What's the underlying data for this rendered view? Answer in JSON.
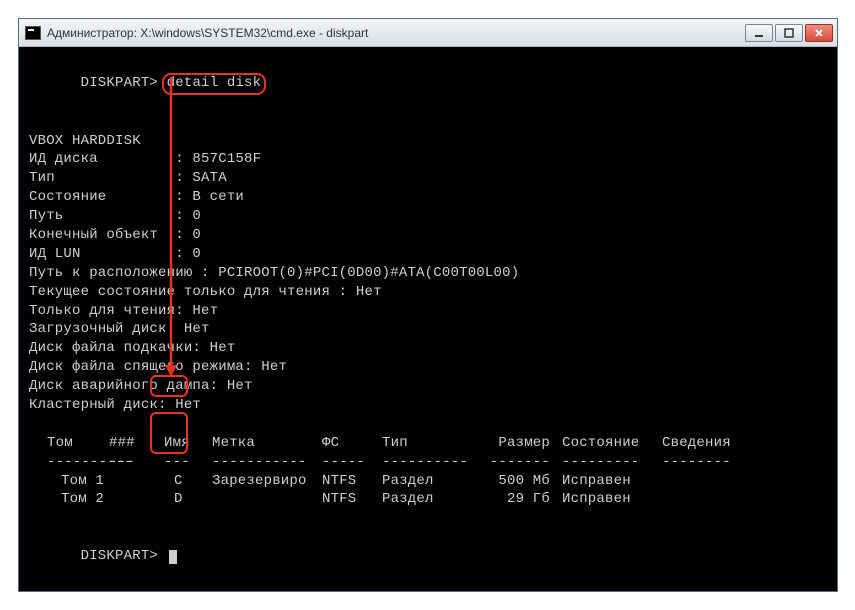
{
  "window": {
    "title": "Администратор: X:\\windows\\SYSTEM32\\cmd.exe - diskpart"
  },
  "prompt": {
    "label": "DISKPART>",
    "command": "detail disk"
  },
  "details": {
    "disk_name": "VBOX HARDDISK",
    "lines": [
      {
        "label": "ИД диска",
        "value": "857C158F"
      },
      {
        "label": "Тип",
        "value": "SATA"
      },
      {
        "label": "Состояние",
        "value": "В сети"
      },
      {
        "label": "Путь",
        "value": "0"
      },
      {
        "label": "Конечный объект",
        "value": "0"
      },
      {
        "label": "ИД LUN",
        "value": "0"
      }
    ],
    "location_label": "Путь к расположению",
    "location_value": "PCIROOT(0)#PCI(0D00)#ATA(C00T00L00)",
    "readonly_state_label": "Текущее состояние только для чтения",
    "readonly_state_value": "Нет",
    "bool_lines": [
      {
        "label": "Только для чтения",
        "value": "Нет"
      },
      {
        "label": "Загрузочный диск",
        "value": "Нет"
      },
      {
        "label": "Диск файла подкачки",
        "value": "Нет"
      },
      {
        "label": "Диск файла спящего режима",
        "value": "Нет"
      },
      {
        "label": "Диск аварийного дампа",
        "value": "Нет"
      },
      {
        "label": "Кластерный диск",
        "value": "Нет"
      }
    ]
  },
  "table": {
    "headers": {
      "tom": "Том",
      "num": "###",
      "name": "Имя",
      "label": "Метка",
      "fs": "ФС",
      "type": "Тип",
      "size": "Размер",
      "status": "Состояние",
      "info": "Сведения"
    },
    "rows": [
      {
        "tom": "Том 1",
        "name": "C",
        "label": "Зарезервиро",
        "fs": "NTFS",
        "type": "Раздел",
        "size": "500 Мб",
        "status": "Исправен",
        "info": ""
      },
      {
        "tom": "Том 2",
        "name": "D",
        "label": "",
        "fs": "NTFS",
        "type": "Раздел",
        "size": "29 Гб",
        "status": "Исправен",
        "info": ""
      }
    ]
  },
  "second_prompt": {
    "label": "DISKPART>"
  }
}
